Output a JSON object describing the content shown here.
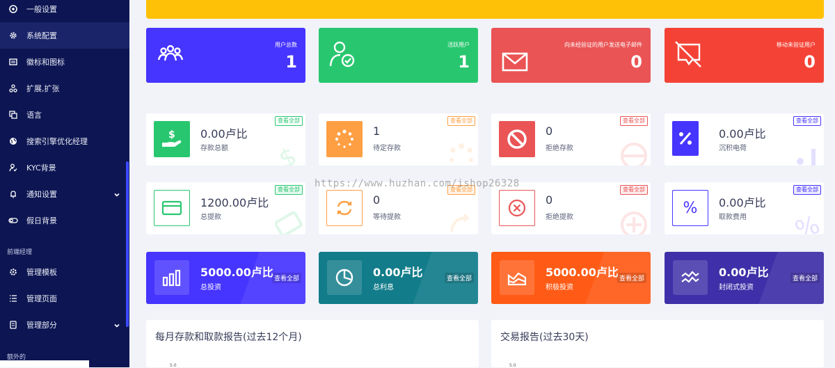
{
  "sidebar": {
    "items": [
      {
        "label": "一般设置",
        "icon": "settings-circle-icon"
      },
      {
        "label": "系统配置",
        "icon": "gear-icon"
      },
      {
        "label": "徽标和图标",
        "icon": "image-icon"
      },
      {
        "label": "扩展,扩张",
        "icon": "puzzle-icon"
      },
      {
        "label": "语言",
        "icon": "language-icon"
      },
      {
        "label": "搜索引擎优化经理",
        "icon": "globe-icon"
      },
      {
        "label": "KYC背景",
        "icon": "user-check-icon"
      },
      {
        "label": "通知设置",
        "icon": "bell-icon"
      },
      {
        "label": "假日背景",
        "icon": "toggle-icon"
      },
      {
        "label": "管理模板",
        "icon": "cog-icon"
      },
      {
        "label": "管理页面",
        "icon": "list-icon"
      },
      {
        "label": "管理部分",
        "icon": "layers-icon"
      }
    ],
    "section_frontend": "前端经理",
    "section_extra": "额外的"
  },
  "top_cards": [
    {
      "title": "用户总数",
      "value": "1",
      "color": "#4634ff",
      "icon": "users-icon"
    },
    {
      "title": "活跃用户",
      "value": "1",
      "color": "#28c76f",
      "icon": "user-check-icon"
    },
    {
      "title": "向未经验证的用户发送电子邮件",
      "value": "0",
      "color": "#ea5455",
      "icon": "envelope-icon"
    },
    {
      "title": "移动未验证用户",
      "value": "0",
      "color": "#f44336",
      "icon": "mobile-off-icon"
    }
  ],
  "mid_cards_row1": [
    {
      "value": "0.00卢比",
      "label": "存款总额",
      "btn": "查看全部",
      "color": "#28c76f",
      "icon": "hand-dollar-icon"
    },
    {
      "value": "1",
      "label": "待定存款",
      "btn": "查看全部",
      "color": "#ff9f43",
      "icon": "spinner-icon"
    },
    {
      "value": "0",
      "label": "拒绝存款",
      "btn": "查看全部",
      "color": "#ea5455",
      "icon": "ban-icon"
    },
    {
      "value": "0.00卢比",
      "label": "沉积电荷",
      "btn": "查看全部",
      "color": "#4634ff",
      "icon": "percent-icon"
    }
  ],
  "mid_cards_row2": [
    {
      "value": "1200.00卢比",
      "label": "总提款",
      "btn": "查看全部",
      "color": "#28c76f",
      "icon": "credit-card-icon"
    },
    {
      "value": "0",
      "label": "等待提款",
      "btn": "查看全部",
      "color": "#ff9f43",
      "icon": "sync-icon"
    },
    {
      "value": "0",
      "label": "拒绝提款",
      "btn": "查看全部",
      "color": "#ea5455",
      "icon": "x-circle-icon"
    },
    {
      "value": "0.00卢比",
      "label": "取款费用",
      "btn": "查看全部",
      "color": "#4634ff",
      "icon": "percent-icon"
    }
  ],
  "grad_cards": [
    {
      "value": "5000.00卢比",
      "label": "总投资",
      "btn": "查看全部",
      "color": "#4634ff",
      "icon": "bar-chart-icon"
    },
    {
      "value": "0.00卢比",
      "label": "总利息",
      "btn": "查看全部",
      "color": "#127c8a",
      "icon": "pie-chart-icon"
    },
    {
      "value": "5000.00卢比",
      "label": "积极投资",
      "btn": "查看全部",
      "color": "#ff5b16",
      "icon": "area-chart-icon"
    },
    {
      "value": "0.00卢比",
      "label": "封闭式投资",
      "btn": "查看全部",
      "color": "#3f2fa8",
      "icon": "wave-chart-icon"
    }
  ],
  "reports": [
    {
      "title": "每月存款和取款报告(过去12个月)",
      "tick": "5.0"
    },
    {
      "title": "交易报告(过去30天)",
      "tick": "5.0"
    }
  ],
  "watermark": "https://www.huzhan.com/ishop26328"
}
